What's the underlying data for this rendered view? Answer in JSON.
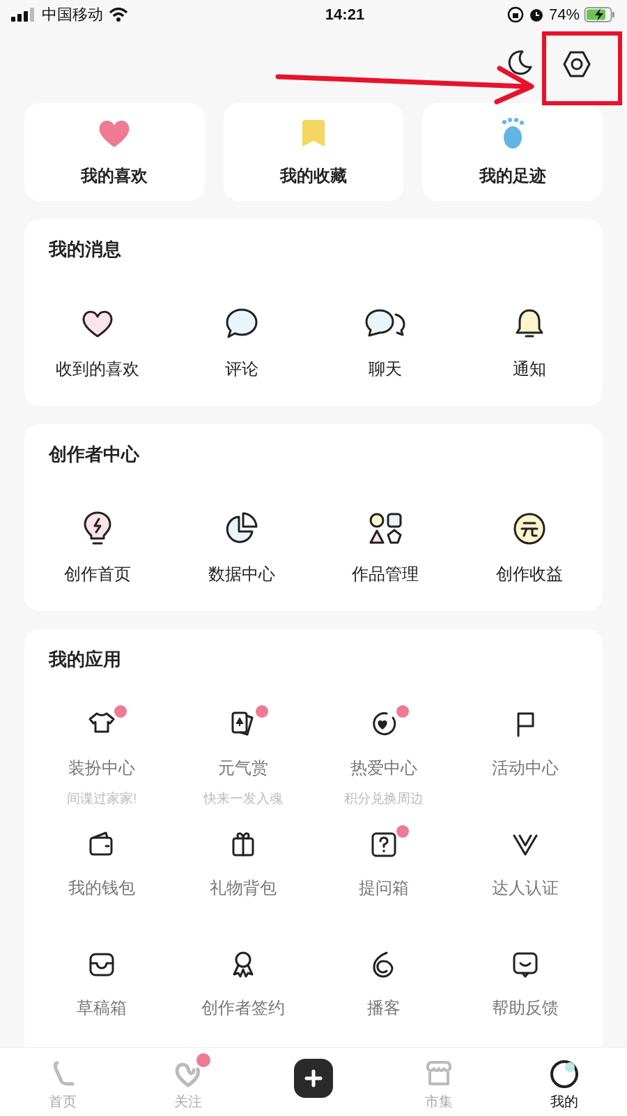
{
  "status_bar": {
    "carrier": "中国移动",
    "time": "14:21",
    "battery": "74%"
  },
  "quick_links": [
    {
      "label": "我的喜欢"
    },
    {
      "label": "我的收藏"
    },
    {
      "label": "我的足迹"
    }
  ],
  "messages": {
    "title": "我的消息",
    "items": [
      {
        "label": "收到的喜欢"
      },
      {
        "label": "评论"
      },
      {
        "label": "聊天"
      },
      {
        "label": "通知"
      }
    ]
  },
  "creator_center": {
    "title": "创作者中心",
    "items": [
      {
        "label": "创作首页"
      },
      {
        "label": "数据中心"
      },
      {
        "label": "作品管理"
      },
      {
        "label": "创作收益"
      }
    ]
  },
  "apps": {
    "title": "我的应用",
    "items": [
      {
        "label": "装扮中心",
        "subtitle": "间谍过家家!",
        "badge": true
      },
      {
        "label": "元气赏",
        "subtitle": "快来一发入魂",
        "badge": true
      },
      {
        "label": "热爱中心",
        "subtitle": "积分兑换周边",
        "badge": true
      },
      {
        "label": "活动中心",
        "badge": false
      },
      {
        "label": "我的钱包",
        "badge": false
      },
      {
        "label": "礼物背包",
        "badge": false
      },
      {
        "label": "提问箱",
        "badge": true
      },
      {
        "label": "达人认证",
        "badge": false
      },
      {
        "label": "草稿箱",
        "badge": false
      },
      {
        "label": "创作者签约",
        "badge": false
      },
      {
        "label": "播客",
        "badge": false
      },
      {
        "label": "帮助反馈",
        "badge": false
      }
    ]
  },
  "tab_bar": [
    {
      "kind": "tab",
      "label": "首页",
      "selected": false,
      "badge": false
    },
    {
      "kind": "tab",
      "label": "关注",
      "selected": false,
      "badge": true
    },
    {
      "kind": "create"
    },
    {
      "kind": "tab",
      "label": "市集",
      "selected": false,
      "badge": false
    },
    {
      "kind": "tab",
      "label": "我的",
      "selected": true,
      "badge": false
    }
  ]
}
